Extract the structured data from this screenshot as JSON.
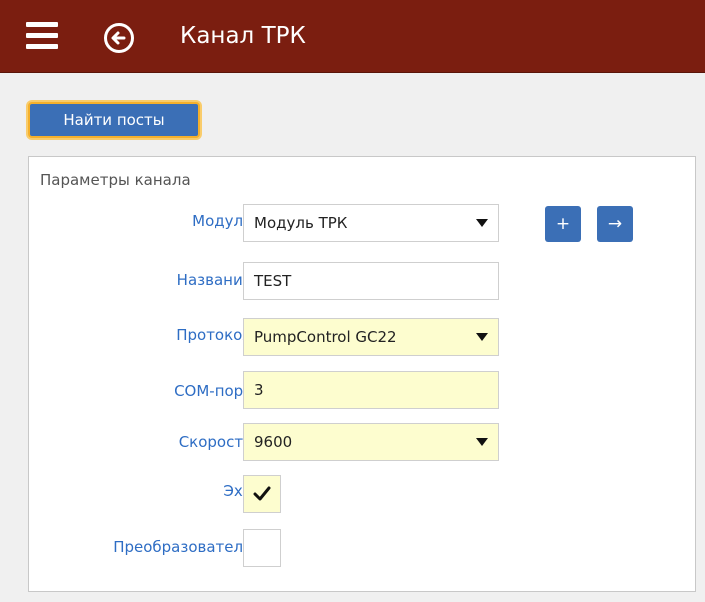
{
  "header": {
    "title": "Канал ТРК",
    "menu_icon": "menu-icon",
    "back_icon": "back-arrow-icon",
    "background": "#7b1e10"
  },
  "find_button": {
    "label": "Найти посты"
  },
  "panel": {
    "title": "Параметры канала",
    "module": {
      "label": "Модуль:",
      "value": "Модуль ТРК"
    },
    "add_button": {
      "label": "+"
    },
    "go_button": {
      "label": "→"
    },
    "name": {
      "label": "Название:",
      "value": "TEST"
    },
    "protocol": {
      "label": "Протокол:",
      "value": "PumpControl GC22"
    },
    "com_port": {
      "label": "COM-порт:",
      "value": "3"
    },
    "speed": {
      "label": "Скорость:",
      "value": "9600"
    },
    "echo": {
      "label": "Эхо:",
      "checked": true
    },
    "converter": {
      "label": "Преобразователь:",
      "checked": false
    }
  },
  "colors": {
    "accent": "#3b6fb6",
    "label": "#2e6dc4",
    "field_highlight": "#fdfdcf",
    "focus": "#f5b02c"
  }
}
